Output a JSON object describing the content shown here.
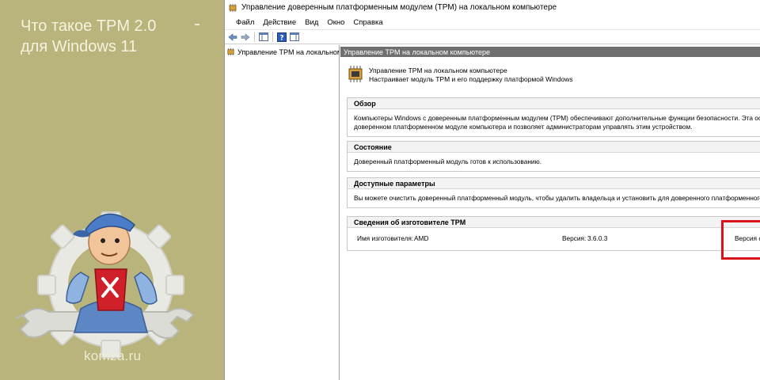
{
  "promo": {
    "title_line1": "Что такое TPM 2.0",
    "title_line2": "для Windows 11",
    "brand": "komza.ru"
  },
  "window": {
    "title": "Управление доверенным платформенным модулем (TPM) на локальном компьютере"
  },
  "menu": {
    "items": [
      "Файл",
      "Действие",
      "Вид",
      "Окно",
      "Справка"
    ]
  },
  "tree": {
    "item_label": "Управление TPM на локальном к"
  },
  "content": {
    "header": "Управление TPM на локальном компьютере",
    "summary_line1": "Управление TPM на локальном компьютере",
    "summary_line2": "Настраивает модуль TPM и его поддержку платформой Windows",
    "sections": {
      "overview": {
        "title": "Обзор",
        "line1": "Компьютеры Windows с доверенным платформенным модулем (TPM) обеспечивают дополнительные функции безопасности. Эта оснастка отобр",
        "line2": "доверенном платформенном модуле компьютера и позволяет администраторам управлять этим устройством."
      },
      "status": {
        "title": "Состояние",
        "text": "Доверенный платформенный модуль готов к использованию."
      },
      "options": {
        "title": "Доступные параметры",
        "text": "Вы можете очистить доверенный платформенный модуль, чтобы удалить владельца и установить для доверенного платформенного модуля зна"
      },
      "manufacturer": {
        "title": "Сведения об изготовителе TPM",
        "name_label": "Имя изготовителя:",
        "name_value": "AMD",
        "version_label": "Версия:",
        "version_value": "3.6.0.3",
        "spec_label": "Версия с"
      }
    }
  },
  "colors": {
    "promo_bg": "#b8b47b",
    "header_bg": "#6f6f6f",
    "highlight": "#d9121b"
  }
}
